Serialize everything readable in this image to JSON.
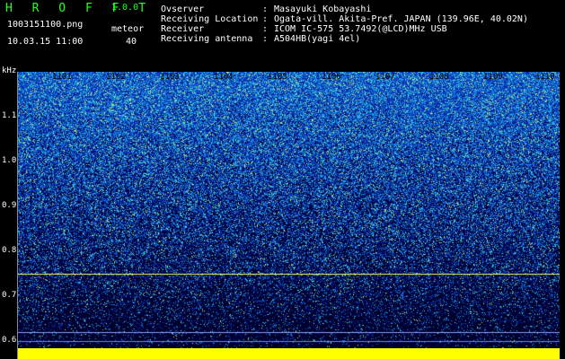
{
  "header": {
    "app_title": "H R O F F T",
    "version": "1.0.0",
    "filename": "1003151100.png",
    "datetime": "10.03.15 11:00",
    "meteor_label": "meteor",
    "meteor_count": "40"
  },
  "info": {
    "labels": [
      "Ovserver",
      "Receiving Location",
      "Receiver",
      "Receiving antenna"
    ],
    "values": [
      "Masayuki Kobayashi",
      "Ogata-vill. Akita-Pref. JAPAN (139.96E, 40.02N)",
      "ICOM IC-575 53.7492(@LCD)MHz USB",
      "A504HB(yagi 4el)"
    ]
  },
  "axis": {
    "unit": "kHz",
    "ticks": [
      "1.1",
      "1.0",
      "0.9",
      "0.8",
      "0.7",
      "0.6"
    ],
    "columns": [
      "1101",
      "1102",
      "1103",
      "1104",
      "1105",
      "1106",
      "1107",
      "1108",
      "1109",
      "1110"
    ]
  },
  "colors": {
    "background": "#000000",
    "title_green": "#22ff22",
    "spectrogram_base": "#08208a",
    "signal_line": "#ffff66",
    "bottom_bar": "#ffff00"
  }
}
